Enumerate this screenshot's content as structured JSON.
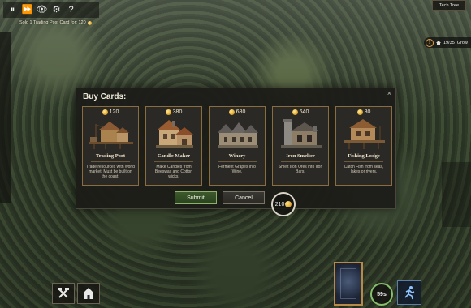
{
  "hud": {
    "controls": [
      {
        "name": "pause-icon",
        "glyph": "⏸"
      },
      {
        "name": "fast-forward-icon",
        "glyph": "⏩"
      },
      {
        "name": "eye-icon",
        "glyph": "👁"
      },
      {
        "name": "gear-icon",
        "glyph": "⚙"
      },
      {
        "name": "help-icon",
        "glyph": "?"
      }
    ],
    "notification": "Sold 1 Trading Post Card for: 120",
    "tech_tree_label": "Tech Tree",
    "population": "19/35",
    "pop_status": "Grow",
    "tokens": "210",
    "timer": "59s"
  },
  "dialog": {
    "title": "Buy Cards:",
    "submit_label": "Submit",
    "cancel_label": "Cancel",
    "cards": [
      {
        "price": "120",
        "name": "Trading Port",
        "desc": "Trade resources with world market. Must be built on the coast."
      },
      {
        "price": "380",
        "name": "Candle Maker",
        "desc": "Make Candles from Beeswax and Cotton wicks."
      },
      {
        "price": "680",
        "name": "Winery",
        "desc": "Ferment Grapes into Wine."
      },
      {
        "price": "640",
        "name": "Iron Smelter",
        "desc": "Smelt Iron Ores into Iron Bars."
      },
      {
        "price": "80",
        "name": "Fishing Lodge",
        "desc": "Catch Fish from seas, lakes or rivers."
      }
    ]
  },
  "colors": {
    "accent_gold": "#e6b13a",
    "card_border": "#8a6d3e",
    "submit_green": "#3d5a2b",
    "timer_ring": "#86c06c"
  }
}
